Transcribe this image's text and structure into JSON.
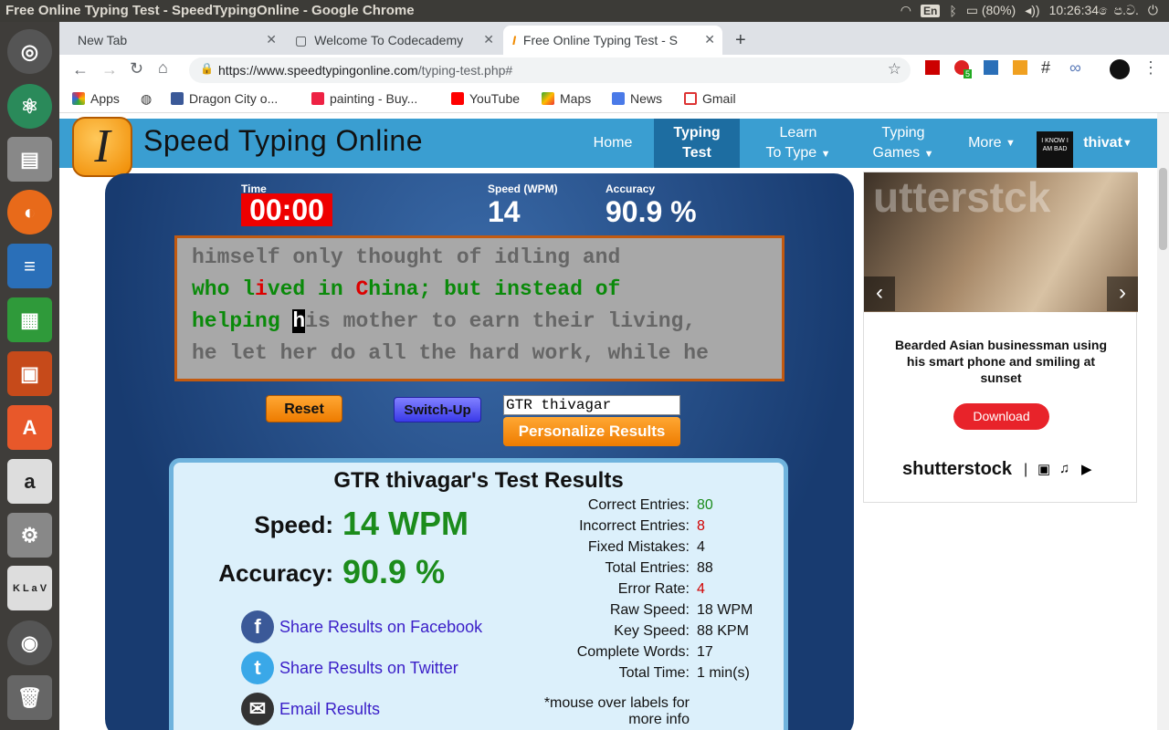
{
  "os": {
    "window_title": "Free Online Typing Test - SpeedTypingOnline - Google Chrome",
    "keyboard_layout": "En",
    "battery": "(80%)",
    "clock": "10:26:34 ෙප.ව."
  },
  "tabs": [
    {
      "label": "New Tab"
    },
    {
      "label": "Welcome To Codecademy"
    },
    {
      "label": "Free Online Typing Test - S"
    }
  ],
  "address": {
    "domain": "https://www.speedtypingonline.com",
    "path": "/typing-test.php#"
  },
  "bookmarks": [
    "Apps",
    "Dragon City o...",
    "painting - Buy...",
    "YouTube",
    "Maps",
    "News",
    "Gmail"
  ],
  "extension_badge": "5",
  "site": {
    "name": "Speed Typing Online",
    "logo_letter": "I",
    "nav": {
      "home": "Home",
      "typing_test_1": "Typing",
      "typing_test_2": "Test",
      "learn_1": "Learn",
      "learn_2": "To Type",
      "games_1": "Typing",
      "games_2": "Games",
      "more": "More",
      "user": "thivat"
    },
    "avatar_text": "I KNOW I AM BAD"
  },
  "test": {
    "time_label": "Time",
    "time": "00:00",
    "speed_label": "Speed (WPM)",
    "speed": "14",
    "accuracy_label": "Accuracy",
    "accuracy": "90.9 %",
    "line1": "himself only thought of idling and",
    "line2_a": "who l",
    "line2_b": "i",
    "line2_c": "ved in ",
    "line2_d": "C",
    "line2_e": "hina; but instead of",
    "line3_a": "helping ",
    "line3_cursor": "h",
    "line3_rest": "is mother to earn their living,",
    "line4": "he let her do all the hard work, while he",
    "reset": "Reset",
    "switch_up": "Switch-Up",
    "name_value": "GTR thivagar",
    "personalize": "Personalize Results"
  },
  "results": {
    "title": "GTR thivagar's Test Results",
    "speed_label": "Speed:",
    "speed_value": "14 WPM",
    "accuracy_label": "Accuracy:",
    "accuracy_value": "90.9 %",
    "share_facebook": "Share Results on Facebook",
    "share_twitter": "Share Results on Twitter",
    "email": "Email Results",
    "stats": [
      {
        "label": "Correct Entries:",
        "value": "80",
        "color": "#1c8c1c"
      },
      {
        "label": "Incorrect Entries:",
        "value": "8",
        "color": "#d00000"
      },
      {
        "label": "Fixed Mistakes:",
        "value": "4",
        "color": "#111111"
      },
      {
        "label": "Total Entries:",
        "value": "88",
        "color": "#111111"
      },
      {
        "label": "Error Rate:",
        "value": "4",
        "color": "#d00000"
      },
      {
        "label": "Raw Speed:",
        "value": "18 WPM",
        "color": "#111111"
      },
      {
        "label": "Key Speed:",
        "value": "88 KPM",
        "color": "#111111"
      },
      {
        "label": "Complete Words:",
        "value": "17",
        "color": "#111111"
      },
      {
        "label": "Total Time:",
        "value": "1 min(s)",
        "color": "#111111"
      }
    ],
    "note_1": "*mouse over labels for",
    "note_2": "more info"
  },
  "ad": {
    "caption": "Bearded Asian businessman using his smart phone and smiling at sunset",
    "download": "Download",
    "brand": "shutterstock",
    "watermark": "utterstck"
  }
}
